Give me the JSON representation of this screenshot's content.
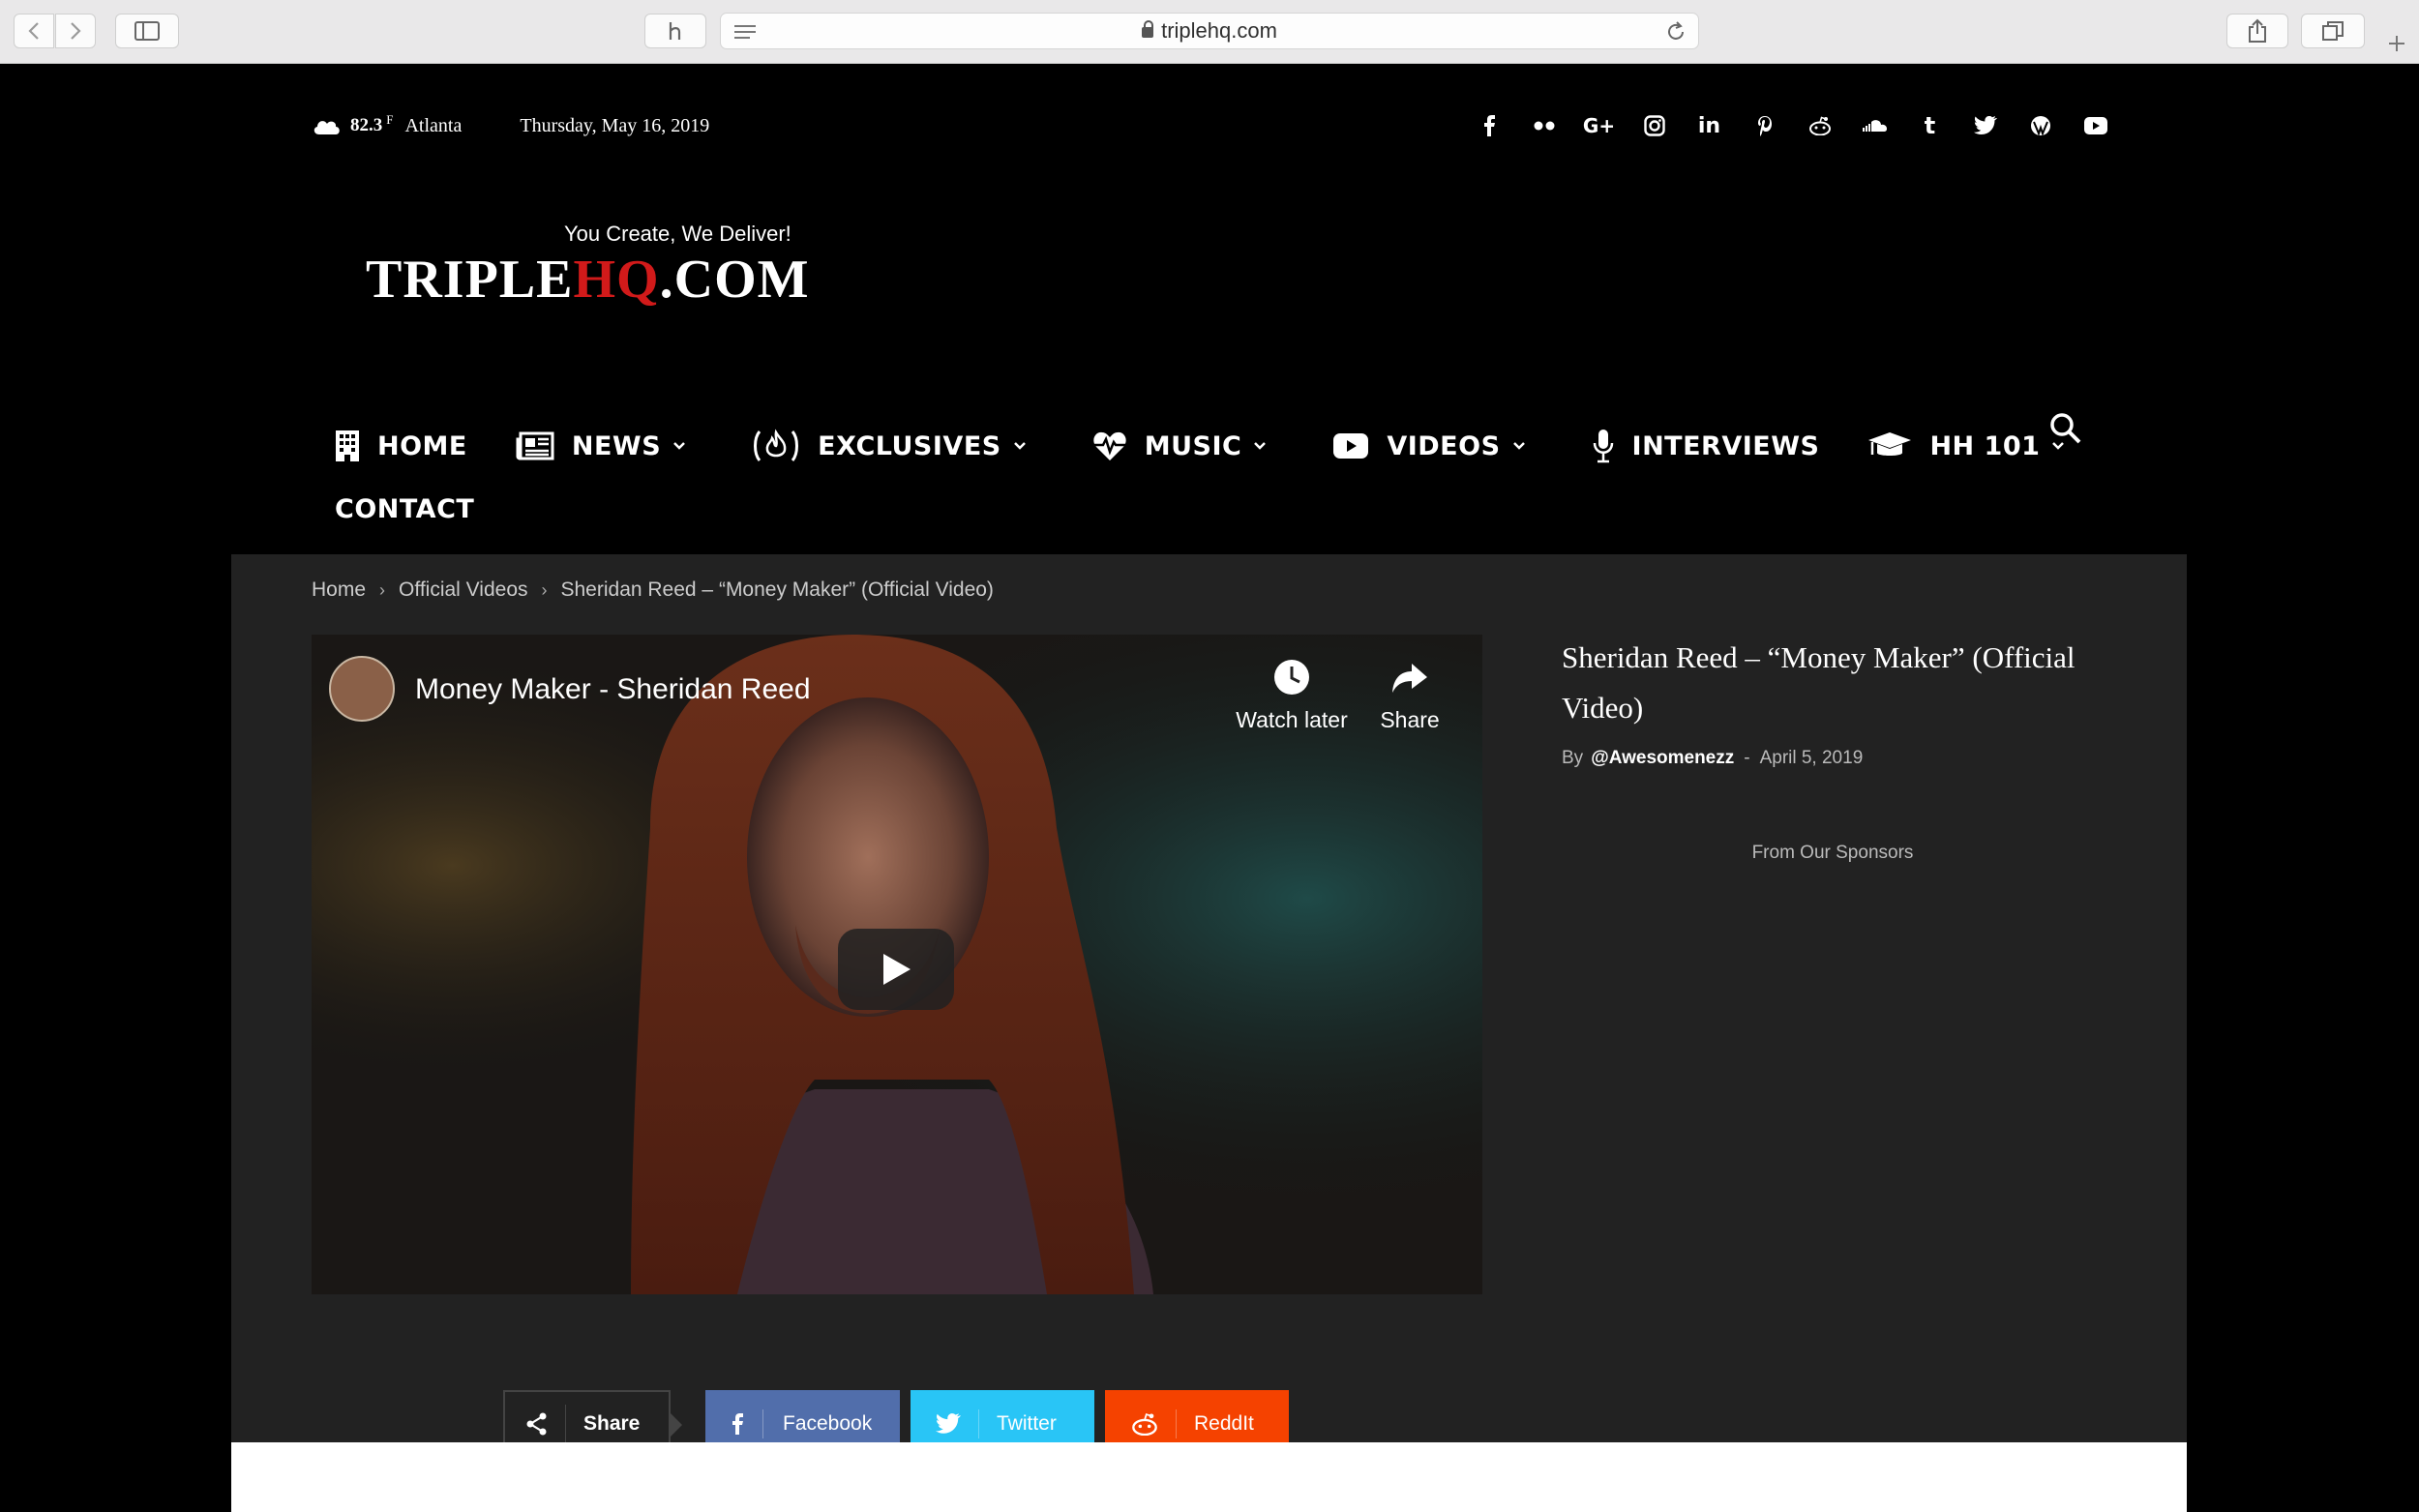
{
  "browser": {
    "url": "triplehq.com"
  },
  "topbar": {
    "temp": "82.3",
    "unit": "F",
    "city": "Atlanta",
    "date": "Thursday, May 16, 2019"
  },
  "social_icons": [
    "facebook-icon",
    "flickr-icon",
    "google-plus-icon",
    "instagram-icon",
    "linkedin-icon",
    "pinterest-icon",
    "reddit-icon",
    "soundcloud-icon",
    "tumblr-icon",
    "twitter-icon",
    "wordpress-icon",
    "youtube-icon"
  ],
  "logo": {
    "tagline": "You Create, We Deliver!",
    "text_a": "TRIPLE",
    "text_b": "HQ",
    "text_c": ".COM"
  },
  "nav": {
    "home": "HOME",
    "news": "NEWS",
    "exclusives": "EXCLUSIVES",
    "music": "MUSIC",
    "videos": "VIDEOS",
    "interviews": "INTERVIEWS",
    "hh101": "HH 101",
    "contact": "CONTACT"
  },
  "breadcrumb": {
    "home": "Home",
    "section": "Official Videos",
    "current": "Sheridan Reed – “Money Maker” (Official Video)"
  },
  "video": {
    "title": "Money Maker - Sheridan Reed",
    "watch_later": "Watch later",
    "share": "Share"
  },
  "share_bar": {
    "label": "Share",
    "facebook": "Facebook",
    "twitter": "Twitter",
    "reddit": "ReddIt"
  },
  "article": {
    "title": "Sheridan Reed – “Money Maker” (Official Video)",
    "by": "By",
    "author": "@Awesomenezz",
    "sep": "-",
    "date": "April 5, 2019"
  },
  "sponsors": "From Our Sponsors",
  "colors": {
    "facebook": "#516eab",
    "twitter": "#29c5f6",
    "reddit": "#f54200",
    "logo_red": "#d11a1a"
  }
}
